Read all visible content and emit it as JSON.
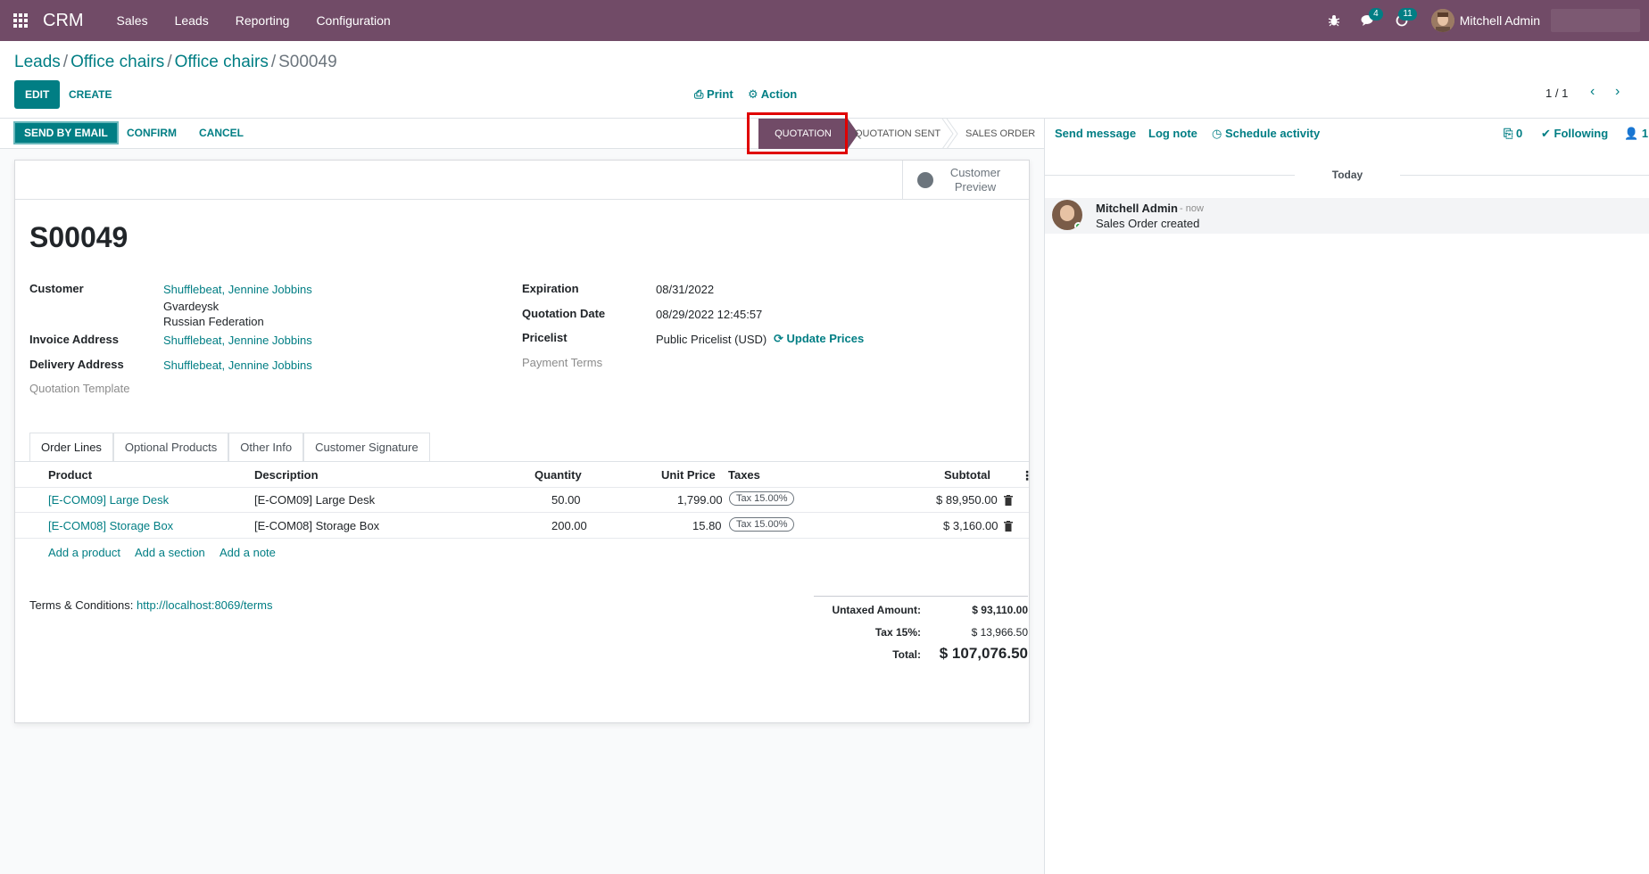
{
  "navbar": {
    "app_name": "CRM",
    "menu": [
      "Sales",
      "Leads",
      "Reporting",
      "Configuration"
    ],
    "messages_count": "4",
    "activities_count": "11",
    "user_name": "Mitchell Admin"
  },
  "breadcrumb": [
    "Leads",
    "Office chairs",
    "Office chairs",
    "S00049"
  ],
  "control": {
    "edit_label": "EDIT",
    "create_label": "CREATE",
    "print_label": "Print",
    "action_label": "Action",
    "pager": "1 / 1"
  },
  "statusbar": {
    "send_email_label": "SEND BY EMAIL",
    "confirm_label": "CONFIRM",
    "cancel_label": "CANCEL",
    "stages": [
      "QUOTATION",
      "QUOTATION SENT",
      "SALES ORDER"
    ],
    "active_stage": "QUOTATION"
  },
  "sheet": {
    "preview_label": "Customer Preview",
    "title": "S00049",
    "customer_label": "Customer",
    "customer_name": "Shufflebeat, Jennine Jobbins",
    "customer_city": "Gvardeysk",
    "customer_country": "Russian Federation",
    "invoice_label": "Invoice Address",
    "invoice_value": "Shufflebeat, Jennine Jobbins",
    "delivery_label": "Delivery Address",
    "delivery_value": "Shufflebeat, Jennine Jobbins",
    "template_label": "Quotation Template",
    "expiration_label": "Expiration",
    "expiration_value": "08/31/2022",
    "qdate_label": "Quotation Date",
    "qdate_value": "08/29/2022 12:45:57",
    "pricelist_label": "Pricelist",
    "pricelist_value": "Public Pricelist (USD)",
    "update_prices_label": "Update Prices",
    "payment_terms_label": "Payment Terms"
  },
  "tabs": [
    "Order Lines",
    "Optional Products",
    "Other Info",
    "Customer Signature"
  ],
  "table": {
    "headers": [
      "Product",
      "Description",
      "Quantity",
      "Unit Price",
      "Taxes",
      "Subtotal"
    ],
    "rows": [
      {
        "product": "[E-COM09] Large Desk",
        "description": "[E-COM09] Large Desk",
        "quantity": "50.00",
        "unit_price": "1,799.00",
        "tax": "Tax 15.00%",
        "subtotal": "$ 89,950.00"
      },
      {
        "product": "[E-COM08] Storage Box",
        "description": "[E-COM08] Storage Box",
        "quantity": "200.00",
        "unit_price": "15.80",
        "tax": "Tax 15.00%",
        "subtotal": "$ 3,160.00"
      }
    ],
    "add_product": "Add a product",
    "add_section": "Add a section",
    "add_note": "Add a note"
  },
  "terms": {
    "label": "Terms & Conditions:",
    "url": "http://localhost:8069/terms"
  },
  "totals": {
    "untaxed_label": "Untaxed Amount:",
    "untaxed_value": "$ 93,110.00",
    "tax_label": "Tax 15%:",
    "tax_value": "$ 13,966.50",
    "total_label": "Total:",
    "total_value": "$ 107,076.50"
  },
  "chatter": {
    "send_message": "Send message",
    "log_note": "Log note",
    "schedule_activity": "Schedule activity",
    "attachments_count": "0",
    "following_label": "Following",
    "followers_count": "1",
    "today_label": "Today",
    "message_author": "Mitchell Admin",
    "message_time": "- now",
    "message_body": "Sales Order created"
  }
}
